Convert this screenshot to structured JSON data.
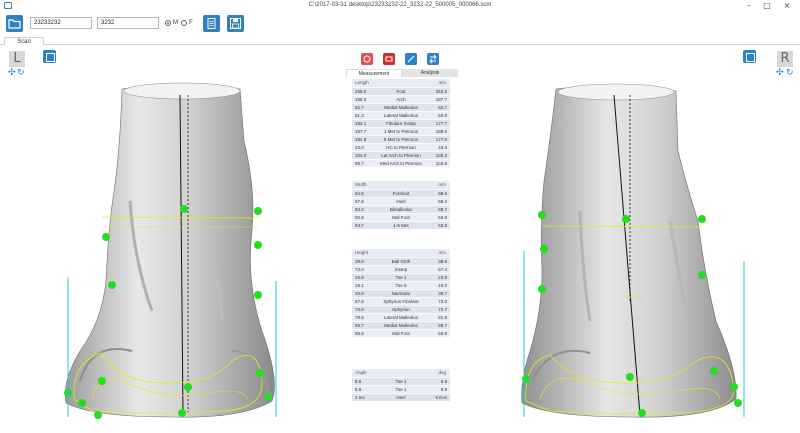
{
  "window": {
    "title": "C:\\2017-03-31 desktop\\23233232-22_3232-22_500005_000066.scm"
  },
  "toolbar": {
    "id_value": "23233232",
    "code_value": "3232",
    "gender_options": [
      {
        "label": "M",
        "selected": true
      },
      {
        "label": "F",
        "selected": false
      }
    ]
  },
  "tabs": [
    "Scan"
  ],
  "left_view": {
    "side_label": "L"
  },
  "right_view": {
    "side_label": "R"
  },
  "panel": {
    "tabs": [
      "Measurement",
      "Analysis"
    ],
    "sections": [
      {
        "header_left": "Length",
        "header_right": "mm",
        "rows": [
          {
            "left": "256.0",
            "label": "Foot",
            "right": "253.5"
          },
          {
            "left": "188.3",
            "label": "Arch",
            "right": "187.7"
          },
          {
            "left": "62.7",
            "label": "Medial Malleolus",
            "right": "62.7"
          },
          {
            "left": "51.3",
            "label": "Lateral Malleolus",
            "right": "50.0"
          },
          {
            "left": "184.1",
            "label": "Fibulare Instep",
            "right": "177.7"
          },
          {
            "left": "187.7",
            "label": "1 Met to Pternion",
            "right": "189.6"
          },
          {
            "left": "184.8",
            "label": "5 Met to Pternion",
            "right": "177.8"
          },
          {
            "left": "43.0",
            "label": "HC to Pternion",
            "right": "43.4"
          },
          {
            "left": "104.0",
            "label": "Lat Arch to Pternion",
            "right": "100.3"
          },
          {
            "left": "99.7",
            "label": "Med Arch to Pternion",
            "right": "103.8"
          }
        ]
      },
      {
        "header_left": "Width",
        "header_right": "mm",
        "rows": [
          {
            "left": "94.5",
            "label": "Forefoot",
            "right": "98.9"
          },
          {
            "left": "67.8",
            "label": "Heel",
            "right": "68.2"
          },
          {
            "left": "83.2",
            "label": "Bimalleolar",
            "right": "88.7"
          },
          {
            "left": "60.8",
            "label": "Mid Foot",
            "right": "63.0"
          },
          {
            "left": "63.7",
            "label": "1-5 Met",
            "right": "63.8"
          }
        ]
      },
      {
        "header_left": "Height",
        "header_right": "mm",
        "rows": [
          {
            "left": "39.6",
            "label": "Ball Girth",
            "right": "38.5"
          },
          {
            "left": "73.0",
            "label": "Instep",
            "right": "67.4"
          },
          {
            "left": "22.8",
            "label": "Toe 1",
            "right": "23.8"
          },
          {
            "left": "19.1",
            "label": "Toe 5",
            "right": "18.0"
          },
          {
            "left": "40.6",
            "label": "Navicular",
            "right": "39.7"
          },
          {
            "left": "67.9",
            "label": "Sphyrion Fibulare",
            "right": "73.0"
          },
          {
            "left": "74.6",
            "label": "Sphyrion",
            "right": "72.7"
          },
          {
            "left": "78.5",
            "label": "Lateral Malleolus",
            "right": "81.8"
          },
          {
            "left": "89.7",
            "label": "Medial Malleolus",
            "right": "88.7"
          },
          {
            "left": "68.6",
            "label": "Mid Foot",
            "right": "66.8"
          }
        ]
      },
      {
        "header_left": "Angle",
        "header_right": "deg",
        "rows": [
          {
            "left": "8.9",
            "label": "Toe 1",
            "right": "6.9"
          },
          {
            "left": "8.9",
            "label": "Toe 1",
            "right": "8.9"
          },
          {
            "left": "2 Inv",
            "label": "Heel",
            "right": "6 Eve"
          }
        ]
      }
    ]
  },
  "colors": {
    "accent": "#2f80c4",
    "mesh": "#d8d8d8",
    "marker": "#22dd22",
    "guide": "#e8e81a"
  }
}
